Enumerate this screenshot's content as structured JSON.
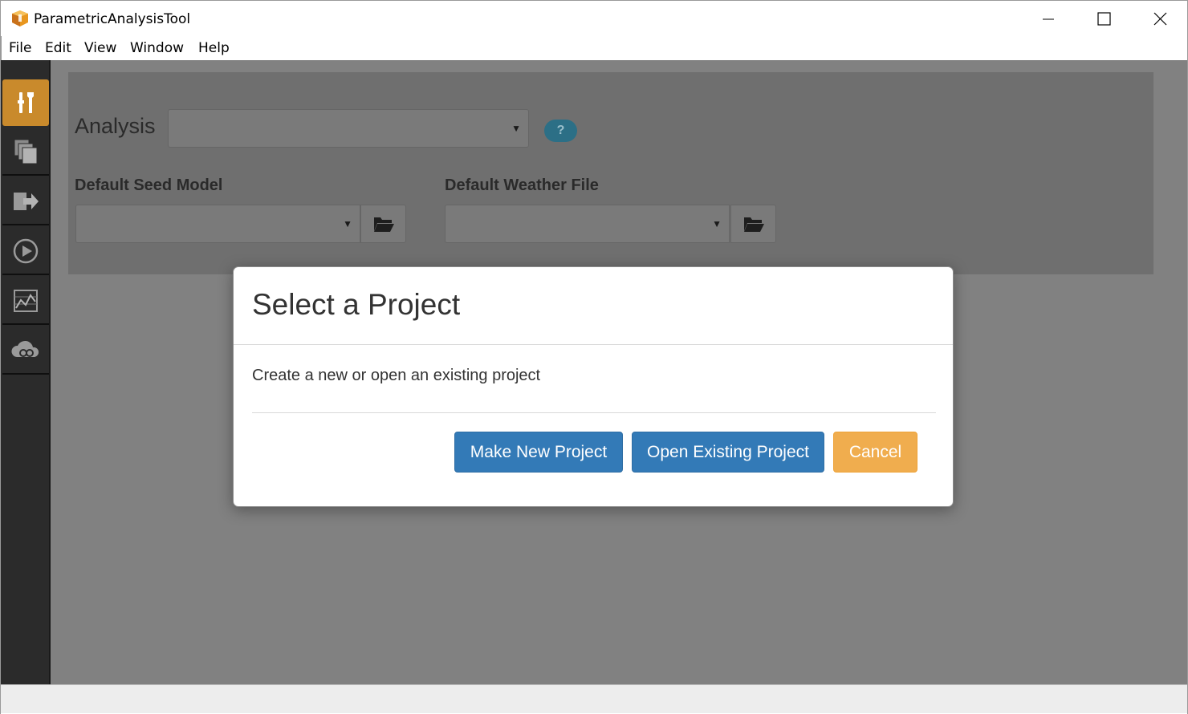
{
  "window": {
    "title": "ParametricAnalysisTool"
  },
  "menu": [
    "File",
    "Edit",
    "View",
    "Window",
    "Help"
  ],
  "sidebar": {
    "items": [
      {
        "icon": "tools-icon",
        "active": true
      },
      {
        "icon": "copy-pages-icon",
        "active": false
      },
      {
        "icon": "export-icon",
        "active": false
      },
      {
        "icon": "play-icon",
        "active": false
      },
      {
        "icon": "chart-report-icon",
        "active": false
      },
      {
        "icon": "cloud-os-icon",
        "active": false
      }
    ]
  },
  "main": {
    "analysis_label": "Analysis",
    "analysis_value": "",
    "help_label": "?",
    "seed_model_label": "Default Seed Model",
    "seed_model_value": "",
    "weather_file_label": "Default Weather File",
    "weather_file_value": ""
  },
  "modal": {
    "title": "Select a Project",
    "body": "Create a new or open an existing project",
    "make_new_label": "Make New Project",
    "open_existing_label": "Open Existing Project",
    "cancel_label": "Cancel"
  },
  "colors": {
    "sidebar_active": "#c98a2c",
    "primary_button": "#337ab7",
    "warning_button": "#f0ad4e"
  }
}
